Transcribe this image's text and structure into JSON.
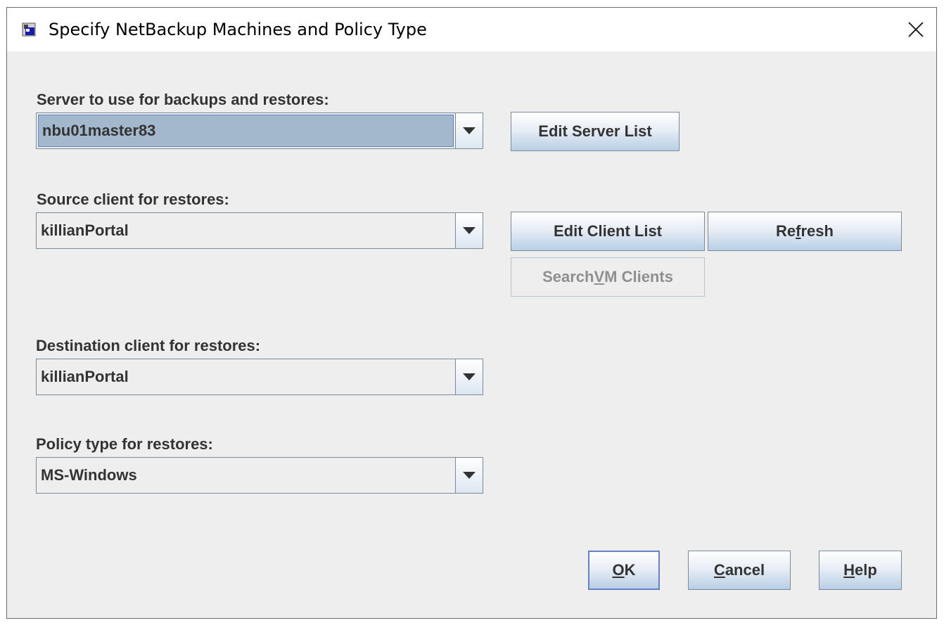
{
  "window": {
    "title": "Specify NetBackup Machines and Policy Type",
    "icon": "netbackup-app-icon",
    "close_icon": "close-icon"
  },
  "server": {
    "label": "Server to use for backups and restores:",
    "value": "nbu01master83",
    "edit_button": "Edit Server List"
  },
  "source_client": {
    "label": "Source client for restores:",
    "value": "killianPortal",
    "edit_button": "Edit Client List",
    "refresh_button": {
      "before": "Re",
      "mnemonic": "f",
      "after": "resh"
    },
    "search_vm_button": {
      "before": "Search ",
      "mnemonic": "V",
      "after": "M Clients",
      "disabled": true
    }
  },
  "destination_client": {
    "label": "Destination client for restores:",
    "value": "killianPortal"
  },
  "policy_type": {
    "label": "Policy type for restores:",
    "value": "MS-Windows"
  },
  "footer": {
    "ok": {
      "mnemonic": "O",
      "after": "K"
    },
    "cancel": {
      "mnemonic": "C",
      "after": "ancel"
    },
    "help": {
      "mnemonic": "H",
      "after": "elp"
    }
  },
  "colors": {
    "dialog_bg": "#eeeeee",
    "selection_bg": "#a3b8cc",
    "label_text": "#333333",
    "disabled_text": "#8e8f91"
  }
}
